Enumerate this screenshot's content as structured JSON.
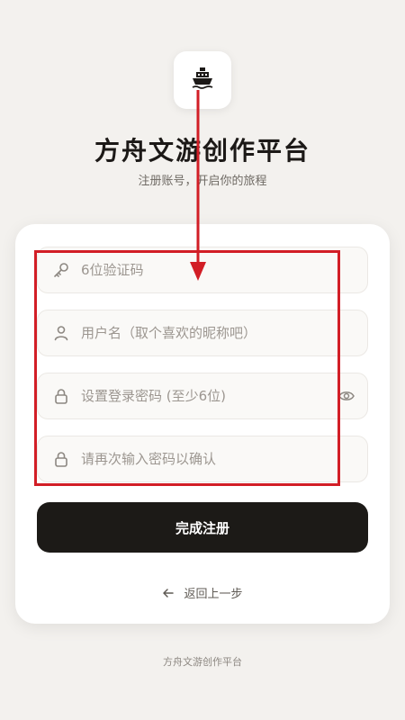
{
  "header": {
    "logo_icon": "ship-icon",
    "title": "方舟文游创作平台",
    "subtitle": "注册账号，开启你的旅程"
  },
  "form": {
    "fields": [
      {
        "icon": "key-icon",
        "placeholder": "6位验证码",
        "value": ""
      },
      {
        "icon": "user-icon",
        "placeholder": "用户名（取个喜欢的昵称吧）",
        "value": ""
      },
      {
        "icon": "lock-icon",
        "placeholder": "设置登录密码 (至少6位)",
        "value": "",
        "trailing_icon": "eye-icon"
      },
      {
        "icon": "lock-icon",
        "placeholder": "请再次输入密码以确认",
        "value": ""
      }
    ],
    "submit_label": "完成注册",
    "back_label": "返回上一步"
  },
  "footer": {
    "text": "方舟文游创作平台"
  },
  "annotation": {
    "color": "#d21e26"
  },
  "colors": {
    "background": "#f3f1ee",
    "primary_button": "#1c1a17"
  }
}
